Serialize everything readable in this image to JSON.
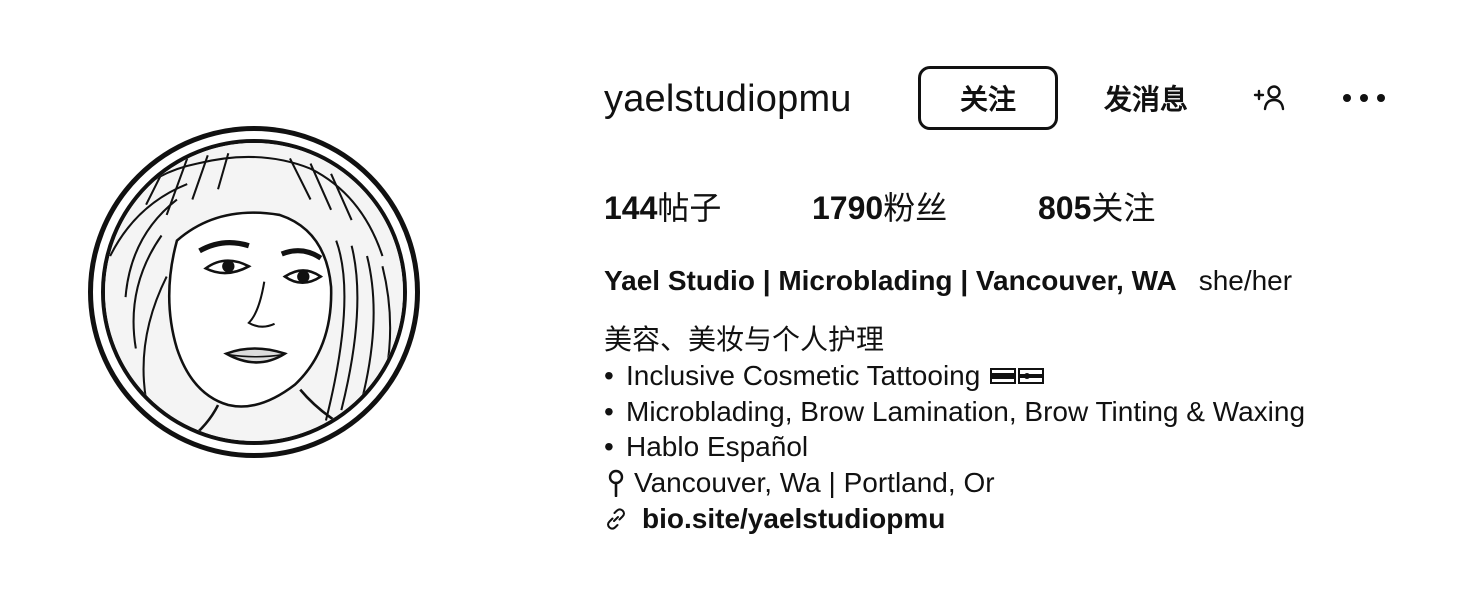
{
  "profile": {
    "username": "yaelstudiopmu",
    "actions": {
      "follow_label": "关注",
      "message_label": "发消息",
      "add_user_icon": "add-person-icon",
      "more_icon": "more-horizontal-icon"
    },
    "stats": {
      "posts": {
        "count": "144",
        "label": "帖子"
      },
      "followers": {
        "count": "1790",
        "label": "粉丝"
      },
      "following": {
        "count": "805",
        "label": "关注"
      }
    },
    "display_name": "Yael Studio | Microblading | Vancouver, WA",
    "pronouns": "she/her",
    "category": "美容、美妆与个人护理",
    "bio_lines": [
      {
        "bullet": "•",
        "text": "Inclusive Cosmetic Tattooing"
      },
      {
        "bullet": "•",
        "text": "Microblading, Brow Lamination, Brow Tinting & Waxing"
      },
      {
        "bullet": "•",
        "text": "Hablo Español"
      }
    ],
    "location": "Vancouver, Wa | Portland, Or",
    "link": "bio.site/yaelstudiopmu"
  },
  "icons": {
    "avatar": "profile-avatar",
    "location": "location-pin-icon",
    "link": "link-icon",
    "flags": [
      "flag-emoji-icon",
      "flag-emoji-icon"
    ]
  }
}
